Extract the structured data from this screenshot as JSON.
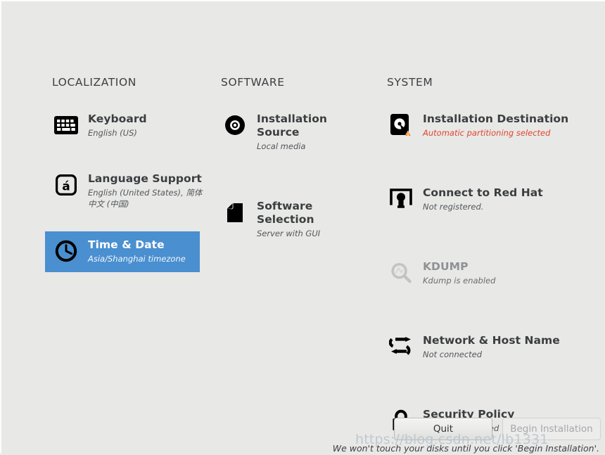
{
  "app": {
    "background_color": "#e8e8e6",
    "selection_color": "#4a8fd0",
    "warning_color": "#e0452f",
    "badge_color": "#f0821e"
  },
  "columns": [
    {
      "id": "localization",
      "title": "LOCALIZATION",
      "items": [
        {
          "id": "keyboard",
          "icon": "keyboard-icon",
          "title": "Keyboard",
          "subtitle": "English (US)",
          "state": "normal"
        },
        {
          "id": "language-support",
          "icon": "language-support-icon",
          "title": "Language Support",
          "subtitle": "English (United States), 简体中文 (中国)",
          "state": "normal"
        },
        {
          "id": "time-and-date",
          "icon": "clock-icon",
          "title": "Time & Date",
          "subtitle": "Asia/Shanghai timezone",
          "state": "selected"
        }
      ]
    },
    {
      "id": "software",
      "title": "SOFTWARE",
      "items": [
        {
          "id": "installation-source",
          "icon": "disc-icon",
          "title": "Installation Source",
          "subtitle": "Local media",
          "state": "normal"
        },
        {
          "id": "software-selection",
          "icon": "package-icon",
          "title": "Software Selection",
          "subtitle": "Server with GUI",
          "state": "normal"
        }
      ]
    },
    {
      "id": "system",
      "title": "SYSTEM",
      "items": [
        {
          "id": "installation-destination",
          "icon": "harddisk-warning-icon",
          "title": "Installation Destination",
          "subtitle": "Automatic partitioning selected",
          "state": "warning"
        },
        {
          "id": "connect-to-red-hat",
          "icon": "subscription-icon",
          "title": "Connect to Red Hat",
          "subtitle": "Not registered.",
          "state": "normal"
        },
        {
          "id": "kdump",
          "icon": "magnifier-icon",
          "title": "KDUMP",
          "subtitle": "Kdump is enabled",
          "state": "disabled"
        },
        {
          "id": "network-and-host-name",
          "icon": "network-arrows-icon",
          "title": "Network & Host Name",
          "subtitle": "Not connected",
          "state": "normal"
        },
        {
          "id": "security-policy",
          "icon": "lock-icon",
          "title": "Security Policy",
          "subtitle": "No profile selected",
          "state": "normal"
        }
      ]
    }
  ],
  "footer": {
    "quit_label": "Quit",
    "begin_label": "Begin Installation",
    "begin_disabled": true,
    "note": "We won't touch your disks until you click 'Begin Installation'."
  },
  "watermark": {
    "text": "https://blog.csdn.net/lb1331"
  }
}
